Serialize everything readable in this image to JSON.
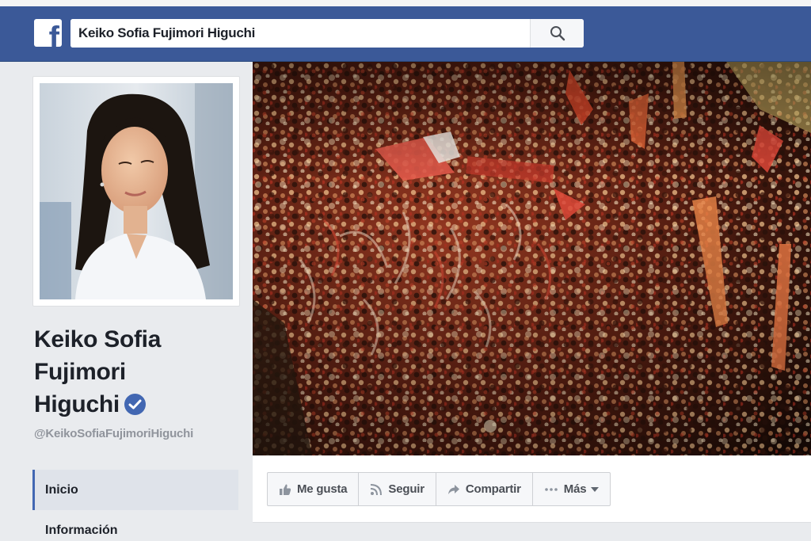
{
  "search": {
    "value": "Keiko Sofia Fujimori Higuchi"
  },
  "profile": {
    "name": "Keiko Sofia Fujimori Higuchi",
    "name_lines": [
      "Keiko Sofia",
      "Fujimori",
      "Higuchi"
    ],
    "handle": "@KeikoSofiaFujimoriHiguchi",
    "verified": true
  },
  "nav": [
    {
      "label": "Inicio",
      "active": true
    },
    {
      "label": "Información",
      "active": false
    }
  ],
  "actions": {
    "like": "Me gusta",
    "follow": "Seguir",
    "share": "Compartir",
    "more": "Más"
  },
  "colors": {
    "brand_blue": "#3b5998",
    "verified_blue": "#4267b2",
    "page_bg": "#e9ebee"
  },
  "icons": {
    "logo": "facebook-f-logo",
    "search": "search-icon",
    "verified": "verified-badge-icon",
    "like": "thumbs-up-icon",
    "follow": "rss-icon",
    "share": "share-arrow-icon",
    "more": "ellipsis-icon"
  }
}
